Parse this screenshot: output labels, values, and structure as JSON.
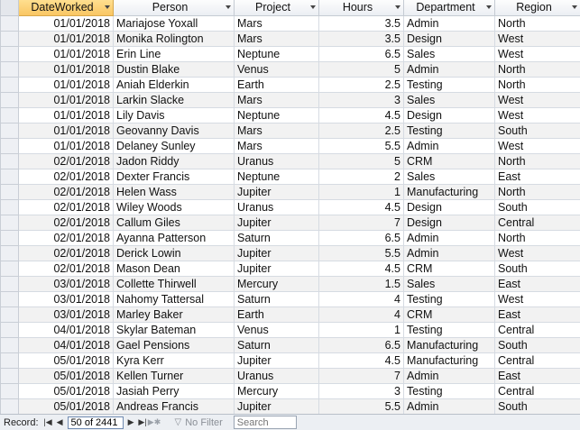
{
  "columns": [
    {
      "label": "DateWorked",
      "sorted": true
    },
    {
      "label": "Person"
    },
    {
      "label": "Project"
    },
    {
      "label": "Hours"
    },
    {
      "label": "Department"
    },
    {
      "label": "Region"
    }
  ],
  "rows": [
    [
      "01/01/2018",
      "Mariajose Yoxall",
      "Mars",
      "3.5",
      "Admin",
      "North"
    ],
    [
      "01/01/2018",
      "Monika Rolington",
      "Mars",
      "3.5",
      "Design",
      "West"
    ],
    [
      "01/01/2018",
      "Erin Line",
      "Neptune",
      "6.5",
      "Sales",
      "West"
    ],
    [
      "01/01/2018",
      "Dustin Blake",
      "Venus",
      "5",
      "Admin",
      "North"
    ],
    [
      "01/01/2018",
      "Aniah Elderkin",
      "Earth",
      "2.5",
      "Testing",
      "North"
    ],
    [
      "01/01/2018",
      "Larkin Slacke",
      "Mars",
      "3",
      "Sales",
      "West"
    ],
    [
      "01/01/2018",
      "Lily Davis",
      "Neptune",
      "4.5",
      "Design",
      "West"
    ],
    [
      "01/01/2018",
      "Geovanny Davis",
      "Mars",
      "2.5",
      "Testing",
      "South"
    ],
    [
      "01/01/2018",
      "Delaney Sunley",
      "Mars",
      "5.5",
      "Admin",
      "West"
    ],
    [
      "02/01/2018",
      "Jadon Riddy",
      "Uranus",
      "5",
      "CRM",
      "North"
    ],
    [
      "02/01/2018",
      "Dexter Francis",
      "Neptune",
      "2",
      "Sales",
      "East"
    ],
    [
      "02/01/2018",
      "Helen Wass",
      "Jupiter",
      "1",
      "Manufacturing",
      "North"
    ],
    [
      "02/01/2018",
      "Wiley Woods",
      "Uranus",
      "4.5",
      "Design",
      "South"
    ],
    [
      "02/01/2018",
      "Callum Giles",
      "Jupiter",
      "7",
      "Design",
      "Central"
    ],
    [
      "02/01/2018",
      "Ayanna Patterson",
      "Saturn",
      "6.5",
      "Admin",
      "North"
    ],
    [
      "02/01/2018",
      "Derick Lowin",
      "Jupiter",
      "5.5",
      "Admin",
      "West"
    ],
    [
      "02/01/2018",
      "Mason Dean",
      "Jupiter",
      "4.5",
      "CRM",
      "South"
    ],
    [
      "03/01/2018",
      "Collette Thirwell",
      "Mercury",
      "1.5",
      "Sales",
      "East"
    ],
    [
      "03/01/2018",
      "Nahomy Tattersal",
      "Saturn",
      "4",
      "Testing",
      "West"
    ],
    [
      "03/01/2018",
      "Marley Baker",
      "Earth",
      "4",
      "CRM",
      "East"
    ],
    [
      "04/01/2018",
      "Skylar Bateman",
      "Venus",
      "1",
      "Testing",
      "Central"
    ],
    [
      "04/01/2018",
      "Gael Pensions",
      "Saturn",
      "6.5",
      "Manufacturing",
      "South"
    ],
    [
      "05/01/2018",
      "Kyra Kerr",
      "Jupiter",
      "4.5",
      "Manufacturing",
      "Central"
    ],
    [
      "05/01/2018",
      "Kellen Turner",
      "Uranus",
      "7",
      "Admin",
      "East"
    ],
    [
      "05/01/2018",
      "Jasiah Perry",
      "Mercury",
      "3",
      "Testing",
      "Central"
    ],
    [
      "05/01/2018",
      "Andreas Francis",
      "Jupiter",
      "5.5",
      "Admin",
      "South"
    ]
  ],
  "navbar": {
    "record_label": "Record:",
    "position": "50 of 2441",
    "filter_icon": "filter-icon",
    "filter_label": "No Filter",
    "search_placeholder": "Search"
  },
  "colors": {
    "sorted_header": "#f9c663",
    "alt_row": "#f2f2f2"
  }
}
